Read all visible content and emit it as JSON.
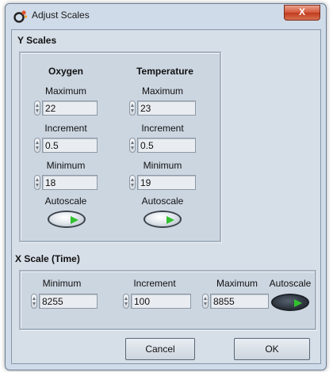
{
  "window": {
    "title": "Adjust Scales",
    "close_label": "X"
  },
  "y_scales": {
    "section_label": "Y Scales",
    "oxygen": {
      "heading": "Oxygen",
      "maximum": {
        "label": "Maximum",
        "value": "22"
      },
      "increment": {
        "label": "Increment",
        "value": "0.5"
      },
      "minimum": {
        "label": "Minimum",
        "value": "18"
      },
      "autoscale": {
        "label": "Autoscale",
        "state": "off"
      }
    },
    "temperature": {
      "heading": "Temperature",
      "maximum": {
        "label": "Maximum",
        "value": "23"
      },
      "increment": {
        "label": "Increment",
        "value": "0.5"
      },
      "minimum": {
        "label": "Minimum",
        "value": "19"
      },
      "autoscale": {
        "label": "Autoscale",
        "state": "off"
      }
    }
  },
  "x_scale": {
    "section_label": "X Scale (Time)",
    "minimum": {
      "label": "Minimum",
      "value": "8255"
    },
    "increment": {
      "label": "Increment",
      "value": "100"
    },
    "maximum": {
      "label": "Maximum",
      "value": "8855"
    },
    "autoscale": {
      "label": "Autoscale",
      "state": "on"
    }
  },
  "buttons": {
    "cancel": "Cancel",
    "ok": "OK"
  },
  "colors": {
    "panel_background": "#d6dee8",
    "indicator_green": "#31c12f",
    "close_button_red": "#c13b1d"
  }
}
